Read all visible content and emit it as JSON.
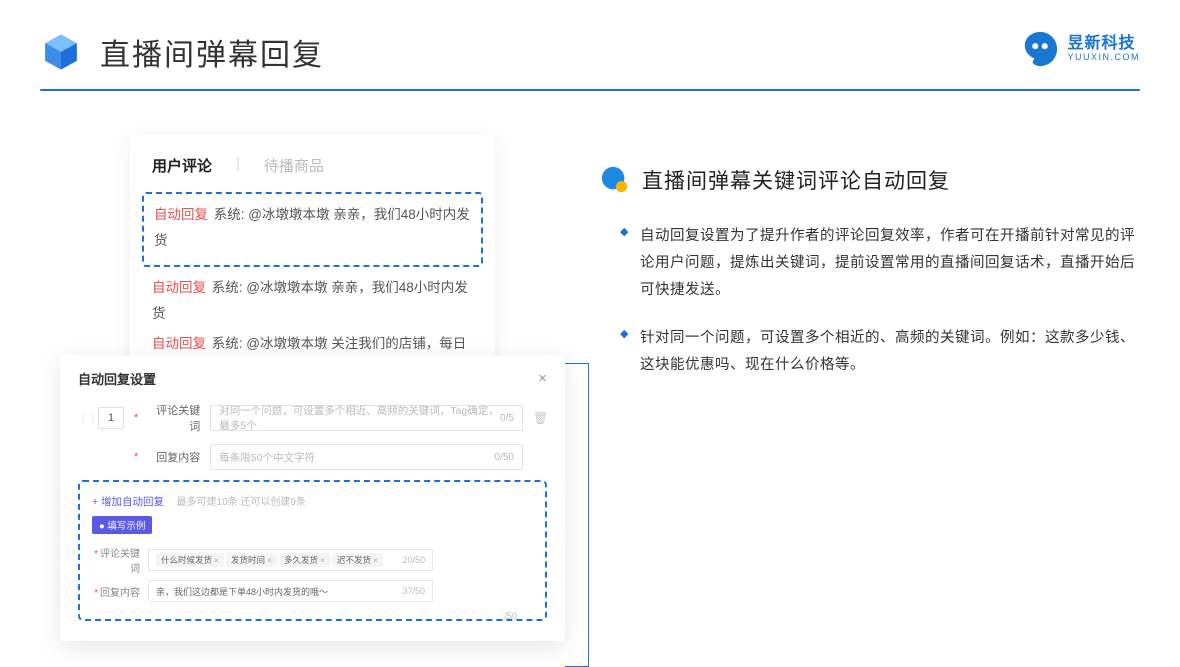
{
  "header": {
    "title": "直播间弹幕回复"
  },
  "brand": {
    "name": "昱新科技",
    "url": "YUUXIN.COM"
  },
  "commentsCard": {
    "tabs": {
      "active": "用户评论",
      "inactive": "待播商品"
    },
    "rows": [
      {
        "tag": "自动回复",
        "sys": "系统:",
        "text": "@冰墩墩本墩 亲亲，我们48小时内发货"
      },
      {
        "tag": "自动回复",
        "sys": "系统:",
        "text": "@冰墩墩本墩 亲亲，我们48小时内发货"
      },
      {
        "tag": "自动回复",
        "sys": "系统:",
        "text": "@冰墩墩本墩 关注我们的店铺，每日都有热门推荐哟～"
      }
    ]
  },
  "settings": {
    "title": "自动回复设置",
    "order": "1",
    "keywordLabel": "评论关键词",
    "keywordPlaceholder": "对同一个问题，可设置多个相近、高频的关键词，Tag确定，最多5个",
    "keywordCount": "0/5",
    "contentLabel": "回复内容",
    "contentPlaceholder": "每条限50个中文字符",
    "contentCount": "0/50",
    "addLink": "+ 增加自动回复",
    "addHint": "最多可建10条 还可以创建9条",
    "exampleBadge": "● 填写示例",
    "exKeywordLabel": "评论关键词",
    "exTags": [
      "什么时候发货",
      "发货时间",
      "多久发货",
      "迟不发货"
    ],
    "exKeywordCount": "20/50",
    "exContentLabel": "回复内容",
    "exContentValue": "亲，我们这边都是下单48小时内发货的哦～",
    "exContentCount": "37/50",
    "strayCount": "/50"
  },
  "right": {
    "sectionTitle": "直播间弹幕关键词评论自动回复",
    "bullets": [
      "自动回复设置为了提升作者的评论回复效率，作者可在开播前针对常见的评论用户问题，提炼出关键词，提前设置常用的直播间回复话术，直播开始后可快捷发送。",
      "针对同一个问题，可设置多个相近的、高频的关键词。例如：这款多少钱、这块能优惠吗、现在什么价格等。"
    ]
  }
}
